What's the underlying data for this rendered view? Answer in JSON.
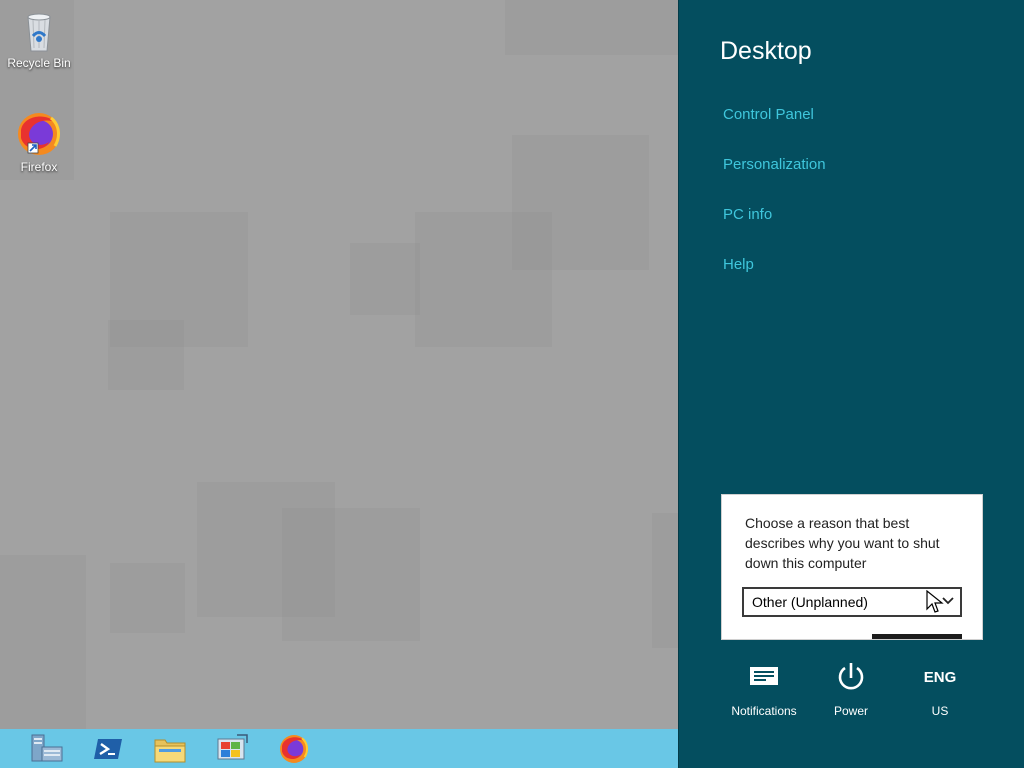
{
  "desktop": {
    "icons": [
      {
        "label": "Recycle Bin",
        "icon": "recycle-bin-icon"
      },
      {
        "label": "Firefox",
        "icon": "firefox-icon"
      }
    ]
  },
  "taskbar": {
    "items": [
      {
        "icon": "server-manager-icon"
      },
      {
        "icon": "powershell-icon"
      },
      {
        "icon": "file-explorer-icon"
      },
      {
        "icon": "system-window-icon"
      },
      {
        "icon": "firefox-icon"
      }
    ],
    "color": "#69c7e6"
  },
  "charms": {
    "title": "Desktop",
    "links": [
      {
        "label": "Control Panel"
      },
      {
        "label": "Personalization"
      },
      {
        "label": "PC info"
      },
      {
        "label": "Help"
      }
    ],
    "background": "#044e5f",
    "link_color": "#3fc6dc",
    "bottom": {
      "notifications": {
        "label": "Notifications",
        "icon": "notifications-icon"
      },
      "power": {
        "label": "Power",
        "icon": "power-icon"
      },
      "language": {
        "code": "ENG",
        "region": "US"
      }
    }
  },
  "shutdown_dialog": {
    "prompt": "Choose a reason that best describes why you want to shut down this computer",
    "selected_reason": "Other (Unplanned)"
  }
}
